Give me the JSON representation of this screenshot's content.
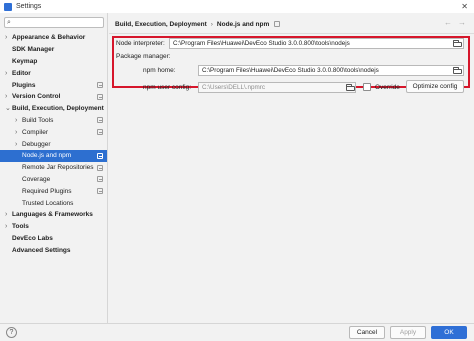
{
  "window": {
    "title": "Settings",
    "close_glyph": "✕"
  },
  "search": {
    "placeholder": "",
    "value": ""
  },
  "sidebar": {
    "items": [
      {
        "label": "Appearance & Behavior",
        "bold": true,
        "chevron": "›",
        "level": 0,
        "project": false,
        "selected": false
      },
      {
        "label": "SDK Manager",
        "bold": true,
        "chevron": "",
        "level": 0,
        "project": false,
        "selected": false
      },
      {
        "label": "Keymap",
        "bold": true,
        "chevron": "",
        "level": 0,
        "project": false,
        "selected": false
      },
      {
        "label": "Editor",
        "bold": true,
        "chevron": "›",
        "level": 0,
        "project": false,
        "selected": false
      },
      {
        "label": "Plugins",
        "bold": true,
        "chevron": "",
        "level": 0,
        "project": true,
        "selected": false
      },
      {
        "label": "Version Control",
        "bold": true,
        "chevron": "›",
        "level": 0,
        "project": true,
        "selected": false
      },
      {
        "label": "Build, Execution, Deployment",
        "bold": true,
        "chevron": "⌄",
        "level": 0,
        "project": false,
        "selected": false
      },
      {
        "label": "Build Tools",
        "bold": false,
        "chevron": "›",
        "level": 1,
        "project": true,
        "selected": false
      },
      {
        "label": "Compiler",
        "bold": false,
        "chevron": "›",
        "level": 1,
        "project": true,
        "selected": false
      },
      {
        "label": "Debugger",
        "bold": false,
        "chevron": "›",
        "level": 1,
        "project": false,
        "selected": false
      },
      {
        "label": "Node.js and npm",
        "bold": false,
        "chevron": "",
        "level": 1,
        "project": true,
        "selected": true
      },
      {
        "label": "Remote Jar Repositories",
        "bold": false,
        "chevron": "",
        "level": 1,
        "project": true,
        "selected": false
      },
      {
        "label": "Coverage",
        "bold": false,
        "chevron": "",
        "level": 1,
        "project": true,
        "selected": false
      },
      {
        "label": "Required Plugins",
        "bold": false,
        "chevron": "",
        "level": 1,
        "project": true,
        "selected": false
      },
      {
        "label": "Trusted Locations",
        "bold": false,
        "chevron": "",
        "level": 1,
        "project": false,
        "selected": false
      },
      {
        "label": "Languages & Frameworks",
        "bold": true,
        "chevron": "›",
        "level": 0,
        "project": false,
        "selected": false
      },
      {
        "label": "Tools",
        "bold": true,
        "chevron": "›",
        "level": 0,
        "project": false,
        "selected": false
      },
      {
        "label": "DevEco Labs",
        "bold": true,
        "chevron": "",
        "level": 0,
        "project": false,
        "selected": false
      },
      {
        "label": "Advanced Settings",
        "bold": true,
        "chevron": "",
        "level": 0,
        "project": false,
        "selected": false
      }
    ]
  },
  "breadcrumb": {
    "parent": "Build, Execution, Deployment",
    "separator": "›",
    "current": "Node.js and npm"
  },
  "nav": {
    "back": "←",
    "forward": "→"
  },
  "form": {
    "node_interpreter_label": "Node interpreter:",
    "node_interpreter_value": "C:\\Program Files\\Huawei\\DevEco Studio 3.0.0.800\\tools\\nodejs",
    "package_manager_label": "Package manager:",
    "npm_home_label": "npm home:",
    "npm_home_value": "C:\\Program Files\\Huawei\\DevEco Studio 3.0.0.800\\tools\\nodejs",
    "npm_user_config_label": "npm user config:",
    "npm_user_config_value": "C:\\Users\\DELL\\.npmrc",
    "override_label": "Override",
    "override_checked": false,
    "optimize_config_label": "Optimize config"
  },
  "footer": {
    "help": "?",
    "cancel": "Cancel",
    "apply": "Apply",
    "ok": "OK"
  },
  "colors": {
    "accent": "#2f6fd6",
    "highlight_border": "#d6162b"
  }
}
